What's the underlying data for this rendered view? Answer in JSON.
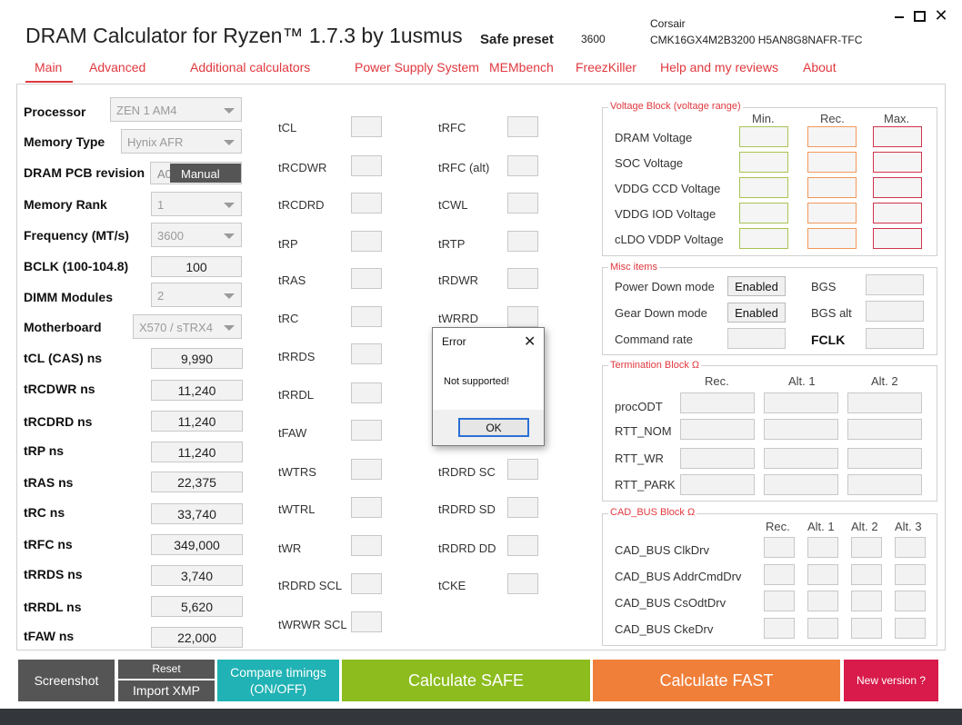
{
  "title": "DRAM Calculator for Ryzen™ 1.7.3 by 1usmus",
  "preset": {
    "label": "Safe preset",
    "value": "3600"
  },
  "kit": {
    "brand": "Corsair",
    "model": "CMK16GX4M2B3200 H5AN8G8NAFR-TFC"
  },
  "tabs": [
    "Main",
    "Advanced",
    "Additional calculators",
    "Power Supply System",
    "MEMbench",
    "FreezKiller",
    "Help and my reviews",
    "About"
  ],
  "left": {
    "processor": {
      "label": "Processor",
      "value": "ZEN 1 AM4"
    },
    "memory_type": {
      "label": "Memory Type",
      "value": "Hynix AFR"
    },
    "pcb": {
      "label": "DRAM PCB revision",
      "value": "A0",
      "option": "Manual"
    },
    "memory_rank": {
      "label": "Memory Rank",
      "value": "1"
    },
    "frequency": {
      "label": "Frequency (MT/s)",
      "value": "3600"
    },
    "bclk": {
      "label": "BCLK (100-104.8)",
      "value": "100"
    },
    "dimm": {
      "label": "DIMM Modules",
      "value": "2"
    },
    "motherboard": {
      "label": "Motherboard",
      "value": "X570 / sTRX4"
    },
    "ns": [
      {
        "label": "tCL (CAS) ns",
        "value": "9,990"
      },
      {
        "label": "tRCDWR ns",
        "value": "11,240"
      },
      {
        "label": "tRCDRD ns",
        "value": "11,240"
      },
      {
        "label": "tRP ns",
        "value": "11,240"
      },
      {
        "label": "tRAS ns",
        "value": "22,375"
      },
      {
        "label": "tRC ns",
        "value": "33,740"
      },
      {
        "label": "tRFC ns",
        "value": "349,000"
      },
      {
        "label": "tRRDS ns",
        "value": "3,740"
      },
      {
        "label": "tRRDL ns",
        "value": "5,620"
      },
      {
        "label": "tFAW ns",
        "value": "22,000"
      }
    ]
  },
  "timings_col1": [
    "tCL",
    "tRCDWR",
    "tRCDRD",
    "tRP",
    "tRAS",
    "tRC",
    "tRRDS",
    "tRRDL",
    "tFAW",
    "tWTRS",
    "tWTRL",
    "tWR",
    "tRDRD SCL",
    "tWRWR SCL"
  ],
  "timings_col2": [
    "tRFC",
    "tRFC (alt)",
    "tCWL",
    "tRTP",
    "tRDWR",
    "tWRRD",
    "tRDRD SC",
    "tRDRD SD",
    "tRDRD DD",
    "tCKE"
  ],
  "voltage": {
    "title": "Voltage Block (voltage range)",
    "headers": [
      "Min.",
      "Rec.",
      "Max."
    ],
    "rows": [
      "DRAM Voltage",
      "SOC Voltage",
      "VDDG  CCD Voltage",
      "VDDG  IOD Voltage",
      "cLDO VDDP Voltage"
    ]
  },
  "misc": {
    "title": "Misc items",
    "power_down": {
      "label": "Power Down mode",
      "value": "Enabled"
    },
    "gear_down": {
      "label": "Gear Down mode",
      "value": "Enabled"
    },
    "command_rate": {
      "label": "Command rate"
    },
    "bgs": "BGS",
    "bgs_alt": "BGS alt",
    "fclk": "FCLK"
  },
  "termination": {
    "title": "Termination Block Ω",
    "headers": [
      "Rec.",
      "Alt. 1",
      "Alt. 2"
    ],
    "rows": [
      "procODT",
      "RTT_NOM",
      "RTT_WR",
      "RTT_PARK"
    ]
  },
  "cadbus": {
    "title": "CAD_BUS Block Ω",
    "headers": [
      "Rec.",
      "Alt. 1",
      "Alt. 2",
      "Alt. 3"
    ],
    "rows": [
      "CAD_BUS ClkDrv",
      "CAD_BUS AddrCmdDrv",
      "CAD_BUS CsOdtDrv",
      "CAD_BUS CkeDrv"
    ]
  },
  "buttons": {
    "screenshot": "Screenshot",
    "reset": "Reset",
    "import_xmp": "Import XMP",
    "compare_line1": "Compare timings",
    "compare_line2": "(ON/OFF)",
    "calc_safe": "Calculate SAFE",
    "calc_fast": "Calculate FAST",
    "new_version": "New version ?"
  },
  "dialog": {
    "title": "Error",
    "message": "Not supported!",
    "ok": "OK"
  },
  "colors": {
    "accent": "#e0383e",
    "safe": "#8cbc1e",
    "fast": "#f07f3a",
    "teal": "#20b2b4",
    "gray_btn": "#555555",
    "new_version": "#d81b4b"
  }
}
